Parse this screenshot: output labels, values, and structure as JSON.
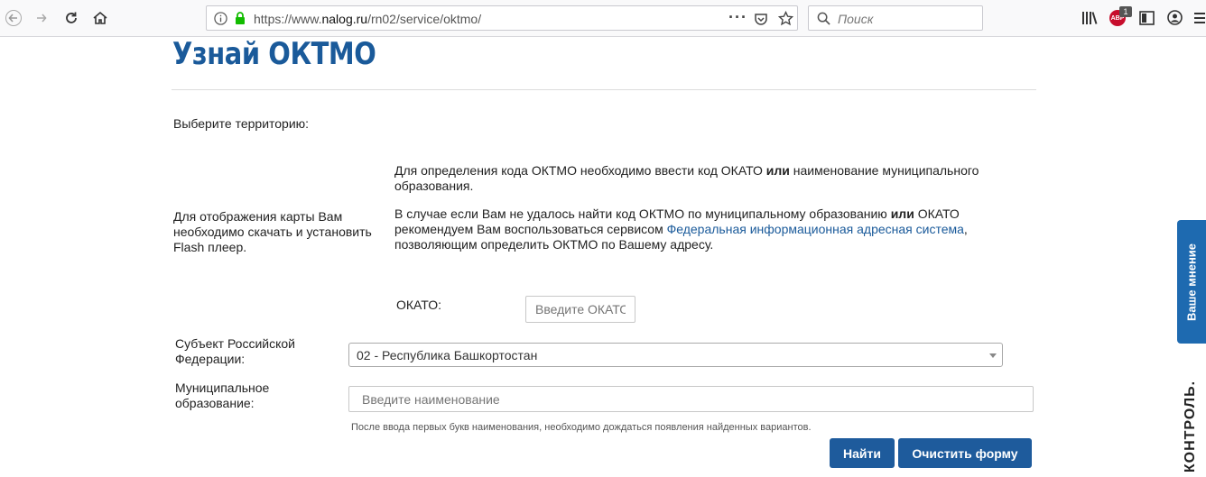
{
  "browser": {
    "url_prefix": "https://www.",
    "url_host": "nalog.ru",
    "url_path": "/rn02/service/oktmo/",
    "search_placeholder": "Поиск",
    "badge_count": "1",
    "adblock_label": "ABP"
  },
  "page": {
    "title": "Узнай ОКТМО",
    "select_territory_label": "Выберите территорию:",
    "flash_notice": "Для отображения карты Вам необходимо скачать и установить Flash плеер.",
    "info1_a": "Для определения кода ОКТМО необходимо ввести код ОКАТО ",
    "info1_bold": "или",
    "info1_b": " наименование муниципального образования.",
    "info2_a": "В случае если Вам не удалось найти код ОКТМО по муниципальному образованию ",
    "info2_bold": "или",
    "info2_b": " ОКАТО рекомендуем Вам воспользоваться сервисом ",
    "info2_link": "Федеральная информационная адресная система",
    "info2_c": ", позволяющим определить ОКТМО по Вашему адресу."
  },
  "form": {
    "okato_label": "ОКАТО:",
    "okato_placeholder": "Введите ОКАТО",
    "subject_label": "Субъект Российской Федерации:",
    "subject_value": "02 - Республика Башкортостан",
    "mo_label": "Муниципальное образование:",
    "mo_placeholder": "Введите наименование",
    "hint": "После ввода первых букв наименования, необходимо дождаться появления найденных вариантов.",
    "find_button": "Найти",
    "clear_button": "Очистить форму"
  },
  "side": {
    "feedback": "Ваше мнение",
    "kontrol": "КОНТРОЛЬ."
  },
  "colors": {
    "brand_blue": "#1e5b9c",
    "title_blue": "#1a5a9a",
    "feedback_blue": "#1e6ab0",
    "lock_green": "#12bc00"
  }
}
